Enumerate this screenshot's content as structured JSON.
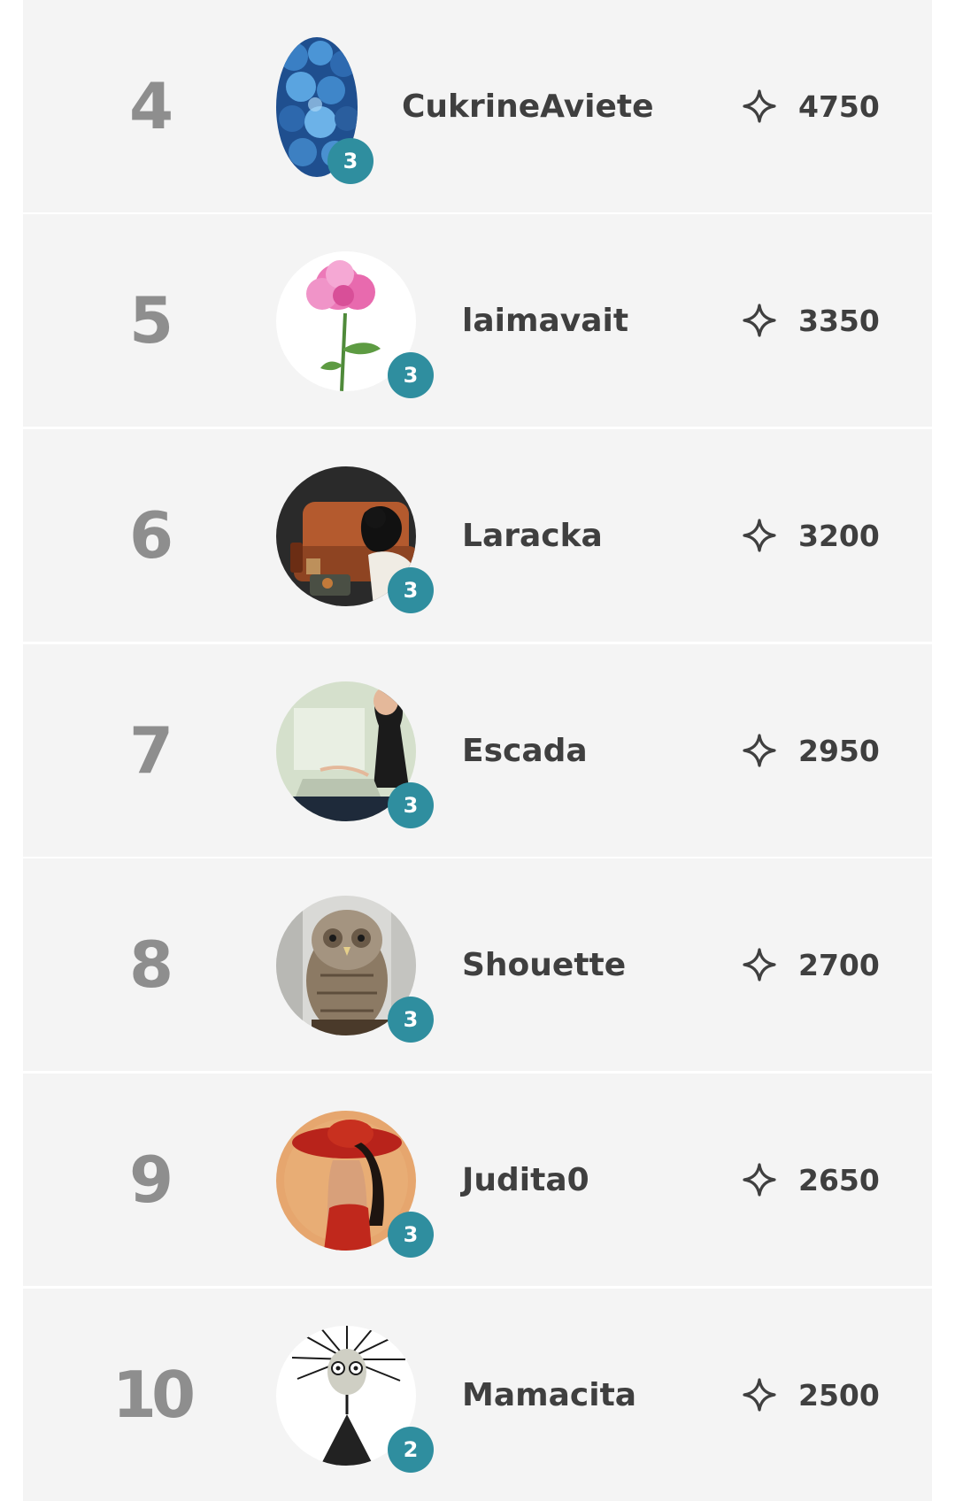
{
  "leaderboard": {
    "rows": [
      {
        "rank": "4",
        "username": "CukrineAviete",
        "level": "3",
        "points": "4750",
        "avatar_icon": "blue-berries-avatar"
      },
      {
        "rank": "5",
        "username": "laimavait",
        "level": "3",
        "points": "3350",
        "avatar_icon": "pink-peony-avatar"
      },
      {
        "rank": "6",
        "username": "Laracka",
        "level": "3",
        "points": "3200",
        "avatar_icon": "black-cat-sofa-avatar"
      },
      {
        "rank": "7",
        "username": "Escada",
        "level": "3",
        "points": "2950",
        "avatar_icon": "woman-at-computer-avatar"
      },
      {
        "rank": "8",
        "username": "Shouette",
        "level": "3",
        "points": "2700",
        "avatar_icon": "owl-avatar"
      },
      {
        "rank": "9",
        "username": "Judita0",
        "level": "3",
        "points": "2650",
        "avatar_icon": "woman-red-hat-avatar"
      },
      {
        "rank": "10",
        "username": "Mamacita",
        "level": "2",
        "points": "2500",
        "avatar_icon": "spiky-hair-doll-avatar"
      }
    ],
    "points_icon": "sparkle-star-icon",
    "colors": {
      "row_background": "#f4f4f4",
      "rank_text": "#8e8e8e",
      "name_text": "#3f3f3f",
      "level_badge": "#2f8e9f"
    }
  }
}
